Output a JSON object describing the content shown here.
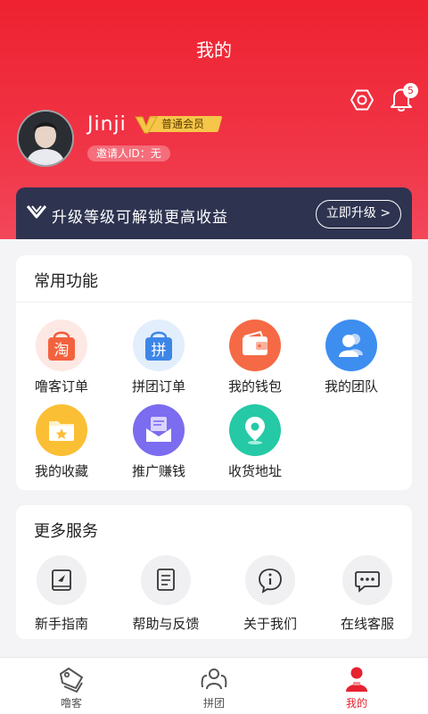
{
  "header": {
    "title": "我的",
    "notification_count": "5"
  },
  "profile": {
    "username": "Jinji",
    "member_level": "普通会员",
    "inviter": "邀请人ID：无"
  },
  "upgrade": {
    "text": "升级等级可解锁更高收益",
    "button": "立即升级 >"
  },
  "common_functions": {
    "title": "常用功能",
    "items": [
      {
        "label": "噜客订单",
        "icon": "taobao-bag-icon",
        "glyph": "淘"
      },
      {
        "label": "拼团订单",
        "icon": "group-bag-icon",
        "glyph": "拼"
      },
      {
        "label": "我的钱包",
        "icon": "wallet-icon"
      },
      {
        "label": "我的团队",
        "icon": "team-icon"
      },
      {
        "label": "我的收藏",
        "icon": "folder-star-icon"
      },
      {
        "label": "推广赚钱",
        "icon": "envelope-icon"
      },
      {
        "label": "收货地址",
        "icon": "location-pin-icon"
      }
    ]
  },
  "more_services": {
    "title": "更多服务",
    "items": [
      {
        "label": "新手指南",
        "icon": "guide-book-icon"
      },
      {
        "label": "帮助与反馈",
        "icon": "feedback-doc-icon"
      },
      {
        "label": "关于我们",
        "icon": "info-icon"
      },
      {
        "label": "在线客服",
        "icon": "chat-icon"
      }
    ]
  },
  "tabbar": {
    "items": [
      {
        "label": "噜客",
        "icon": "tag-icon",
        "active": false
      },
      {
        "label": "拼团",
        "icon": "people-icon",
        "active": false
      },
      {
        "label": "我的",
        "icon": "person-icon",
        "active": true
      }
    ]
  },
  "colors": {
    "brand_red": "#ee2230",
    "upgrade_bg": "#2e3350",
    "vip_gold": "#f6c64a"
  }
}
